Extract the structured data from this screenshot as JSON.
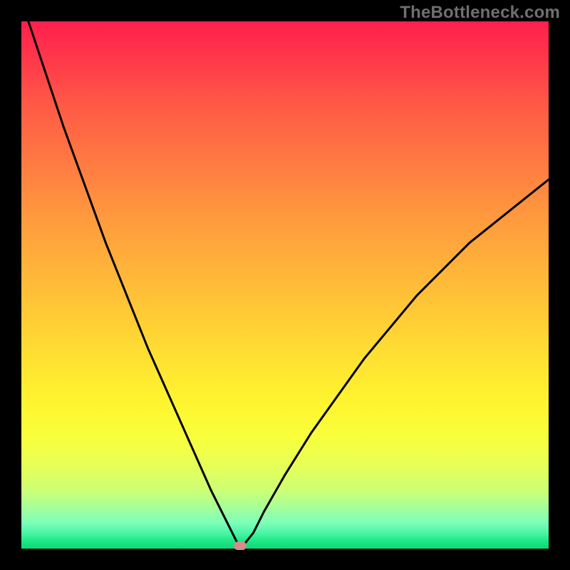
{
  "watermark": "TheBottleneck.com",
  "chart_data": {
    "type": "line",
    "title": "",
    "xlabel": "",
    "ylabel": "",
    "xlim": [
      0,
      100
    ],
    "ylim": [
      0,
      100
    ],
    "grid": false,
    "series": [
      {
        "name": "curve",
        "x": [
          0,
          4,
          8,
          12,
          16,
          20,
          24,
          28,
          32,
          36,
          38,
          40,
          41,
          42,
          44,
          46,
          50,
          55,
          60,
          65,
          70,
          75,
          80,
          85,
          90,
          95,
          100
        ],
        "y": [
          104,
          92,
          80,
          69,
          58,
          48,
          38,
          29,
          20,
          11,
          7,
          3,
          1,
          0.5,
          3,
          7,
          14,
          22,
          29,
          36,
          42,
          48,
          53,
          58,
          62,
          66,
          70
        ]
      }
    ],
    "marker": {
      "x": 41.5,
      "y": 0.6
    },
    "background_gradient": {
      "top": "#ff1f4d",
      "mid": "#fff42f",
      "bottom": "#0bd877"
    }
  }
}
